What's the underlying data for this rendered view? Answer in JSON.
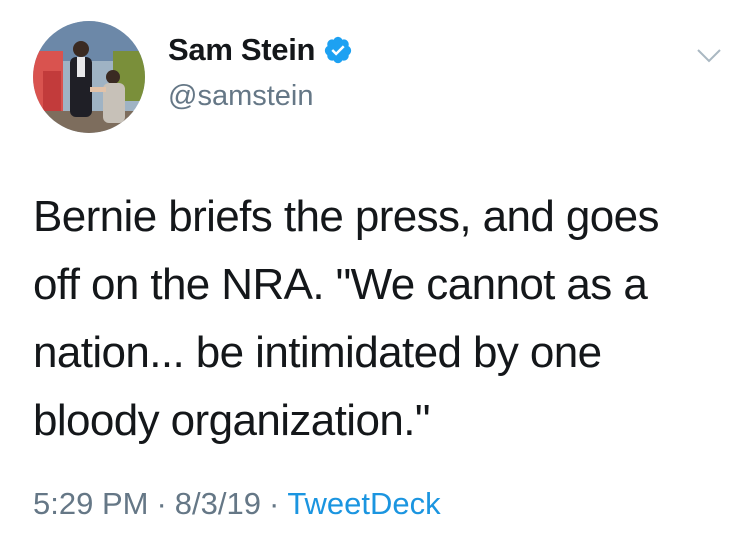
{
  "author": {
    "display_name": "Sam Stein",
    "handle": "@samstein",
    "verified": true
  },
  "tweet": {
    "text": "Bernie briefs the press, and goes\noff on the NRA. \"We cannot as a\nnation... be intimidated by one\nbloody organization.\"",
    "time": "5:29 PM",
    "date": "8/3/19",
    "source": "TweetDeck",
    "separator": "·"
  },
  "icons": {
    "verified": "verified-badge-icon",
    "menu": "chevron-down-icon"
  },
  "colors": {
    "text": "#14171a",
    "secondary": "#657786",
    "link": "#1b95e0",
    "verified": "#1da1f2"
  }
}
